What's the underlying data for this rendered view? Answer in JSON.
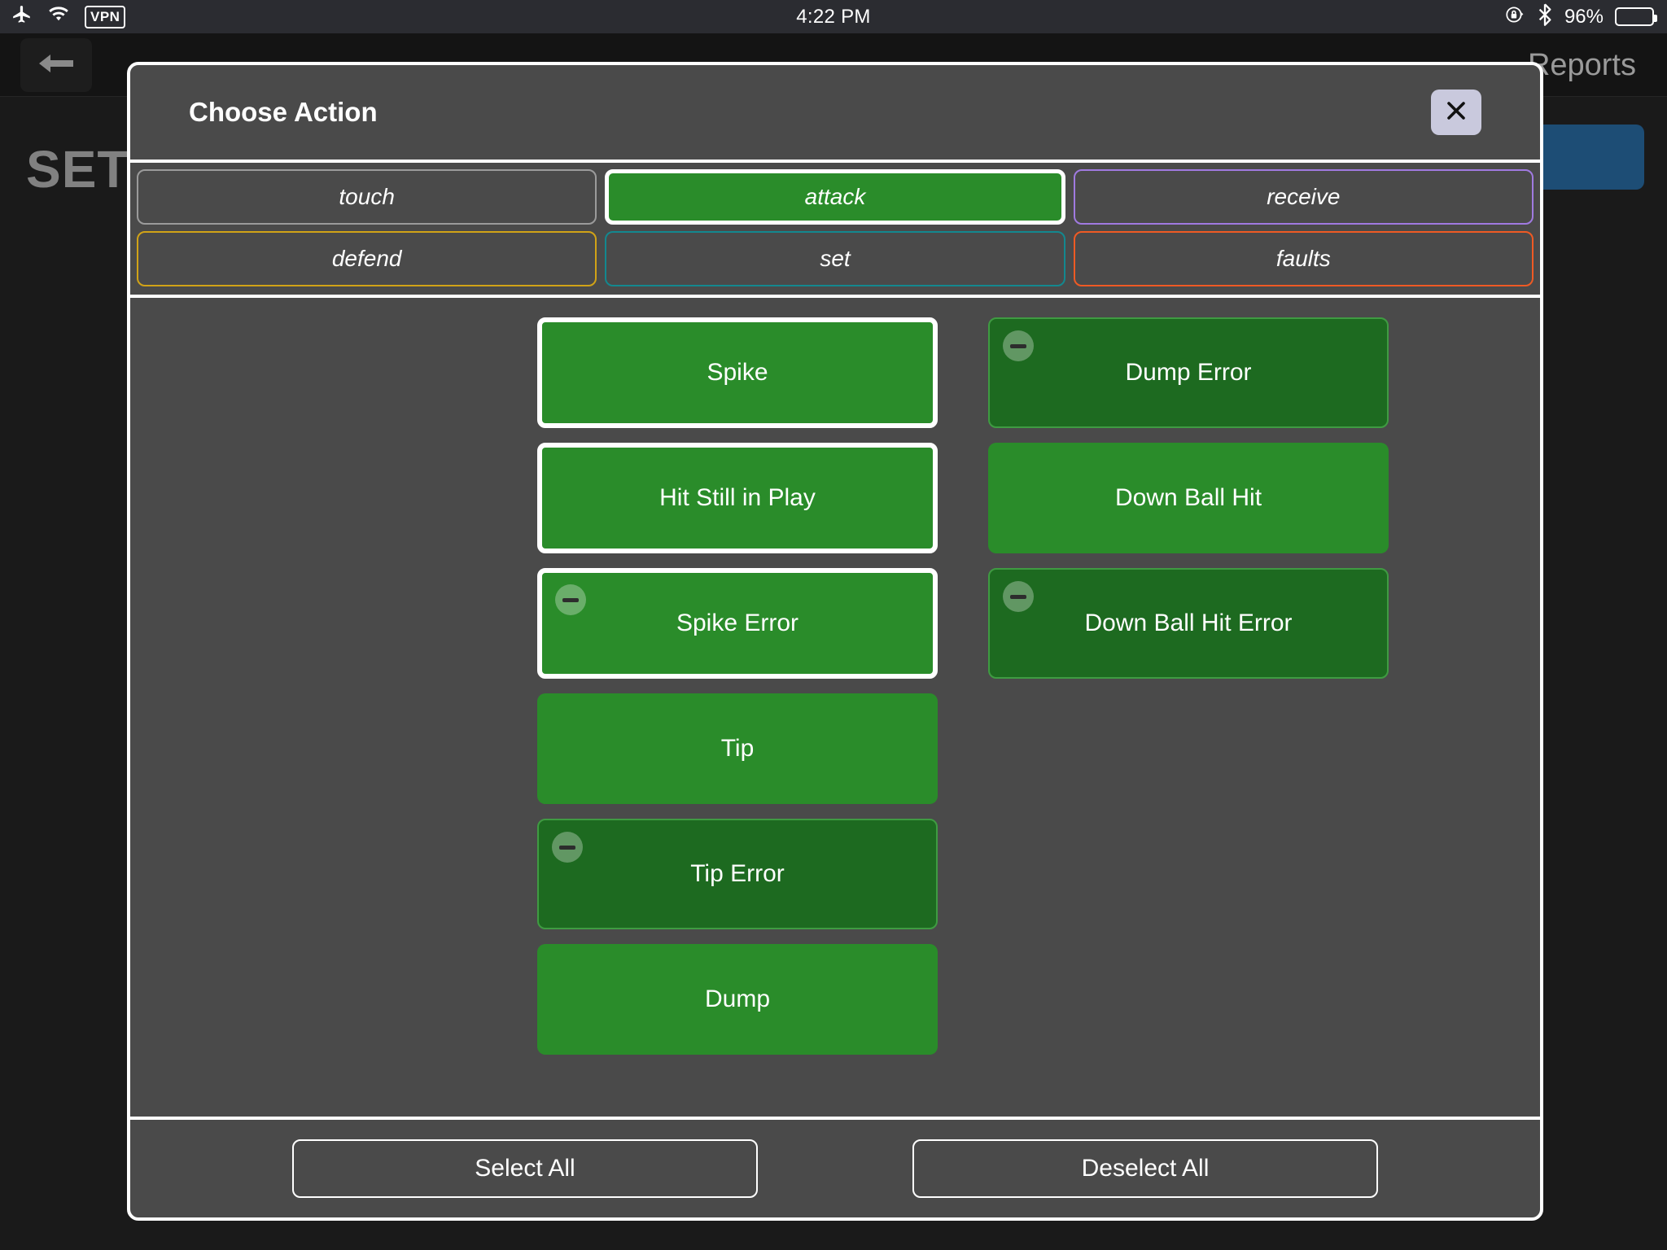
{
  "status_bar": {
    "airplane_icon": "airplane-icon",
    "wifi_icon": "wifi-icon",
    "vpn_label": "VPN",
    "time": "4:22 PM",
    "rotation_lock_icon": "rotation-lock-icon",
    "bluetooth_icon": "bluetooth-icon",
    "battery_percent": "96%",
    "battery_fill": 96
  },
  "background_app": {
    "back_icon": "back-arrow-icon",
    "nav_right_label": "Reports",
    "page_title": "SETUP",
    "menu_icon": "hamburger-icon",
    "accent_blue": "#1d4d75"
  },
  "modal": {
    "title": "Choose Action",
    "close_icon": "close-icon",
    "tabs": [
      {
        "label": "touch",
        "selected": false,
        "border_color": "#9b9b9b"
      },
      {
        "label": "attack",
        "selected": true,
        "border_color": "#ffffff"
      },
      {
        "label": "receive",
        "selected": false,
        "border_color": "#a07ae0"
      },
      {
        "label": "defend",
        "selected": false,
        "border_color": "#d1a317"
      },
      {
        "label": "set",
        "selected": false,
        "border_color": "#13888f"
      },
      {
        "label": "faults",
        "selected": false,
        "border_color": "#ef5a24"
      }
    ],
    "columns": [
      {
        "items": [
          {
            "label": "Spike",
            "selected": true,
            "dim": false,
            "badge": false
          },
          {
            "label": "Hit Still in Play",
            "selected": true,
            "dim": false,
            "badge": false
          },
          {
            "label": "Spike Error",
            "selected": true,
            "dim": false,
            "badge": true
          },
          {
            "label": "Tip",
            "selected": false,
            "dim": false,
            "badge": false
          },
          {
            "label": "Tip Error",
            "selected": false,
            "dim": true,
            "badge": true
          },
          {
            "label": "Dump",
            "selected": false,
            "dim": false,
            "badge": false
          }
        ]
      },
      {
        "items": [
          {
            "label": "Dump Error",
            "selected": false,
            "dim": true,
            "badge": true
          },
          {
            "label": "Down Ball Hit",
            "selected": false,
            "dim": false,
            "badge": false
          },
          {
            "label": "Down Ball Hit Error",
            "selected": false,
            "dim": true,
            "badge": true
          }
        ]
      }
    ],
    "footer": {
      "select_all_label": "Select All",
      "deselect_all_label": "Deselect All"
    },
    "colors": {
      "selected_green": "#2a8c2a",
      "dim_green": "#1d6a20",
      "panel_gray": "#4a4a4a",
      "border_white": "#ffffff"
    }
  }
}
